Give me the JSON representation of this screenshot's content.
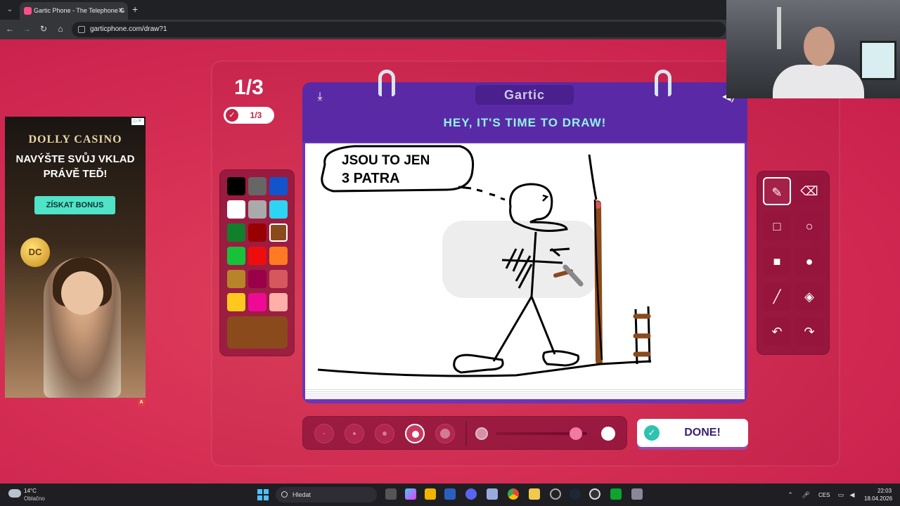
{
  "browser": {
    "tab_title": "Gartic Phone - The Telephone G",
    "url": "garticphone.com/draw?1"
  },
  "ad": {
    "brand": "DOLLY CASINO",
    "headline": "NAVÝŠTE SVŮJ VKLAD PRÁVĚ TEĎ!",
    "cta": "ZÍSKAT BONUS",
    "coin_text": "DC",
    "adchoices": "A"
  },
  "round": {
    "title": "1/3",
    "pill": "1/3"
  },
  "board": {
    "logo": "Gartic",
    "title": "HEY, IT'S TIME TO DRAW!",
    "drawing_text_line1": "JSOU TO JEN",
    "drawing_text_line2": "3 PATRA"
  },
  "palette": {
    "colors": [
      "#000000",
      "#666666",
      "#1155cc",
      "#ffffff",
      "#aaaaaa",
      "#2ed4f4",
      "#11802b",
      "#990000",
      "#8a4a1c",
      "#18c13a",
      "#ee0d0d",
      "#ff7a22",
      "#b8842a",
      "#990048",
      "#d6575e",
      "#ffc81e",
      "#ee0a95",
      "#feafa8"
    ],
    "selected_color": "#8a4a1c"
  },
  "tools": [
    "pen-icon",
    "eraser-icon",
    "square-outline-icon",
    "circle-outline-icon",
    "square-fill-icon",
    "circle-fill-icon",
    "line-icon",
    "fill-bucket-icon",
    "undo-icon",
    "redo-icon"
  ],
  "brush": {
    "selected_size_index": 3,
    "opacity": 0.88
  },
  "done_label": "DONE!",
  "taskbar": {
    "weather_temp": "14°C",
    "weather_desc": "Oblačno",
    "search_placeholder": "Hledat",
    "language": "CES",
    "time": "22:03",
    "date": "18.04.2026"
  }
}
